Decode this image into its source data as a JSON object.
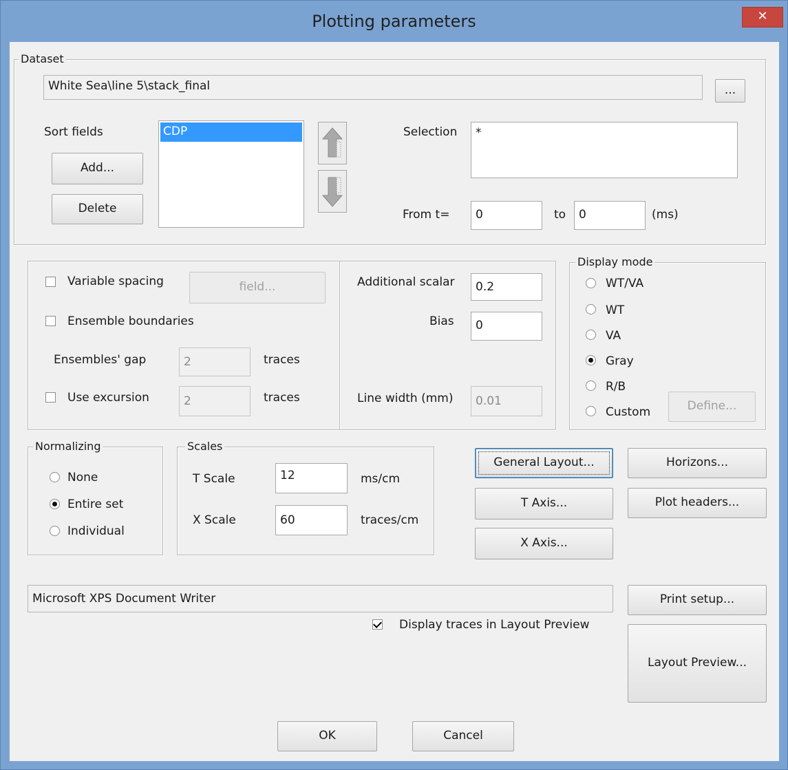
{
  "window": {
    "title": "Plotting parameters",
    "close_glyph": "✕"
  },
  "dataset": {
    "legend": "Dataset",
    "path": "White Sea\\line 5\\stack_final",
    "browse_label": "...",
    "sort_fields_label": "Sort fields",
    "add_label": "Add...",
    "delete_label": "Delete",
    "sort_list": [
      "CDP"
    ],
    "selection_label": "Selection",
    "selection_value": "*",
    "from_label": "From t=",
    "from_value": "0",
    "to_label": "to",
    "to_value": "0",
    "unit_label": "(ms)"
  },
  "options": {
    "variable_spacing_label": "Variable spacing",
    "variable_spacing_checked": false,
    "field_button_label": "field...",
    "ensemble_boundaries_label": "Ensemble boundaries",
    "ensemble_boundaries_checked": false,
    "ensembles_gap_label": "Ensembles' gap",
    "ensembles_gap_value": "2",
    "traces_label_1": "traces",
    "use_excursion_label": "Use excursion",
    "use_excursion_checked": false,
    "excursion_value": "2",
    "traces_label_2": "traces",
    "additional_scalar_label": "Additional scalar",
    "additional_scalar_value": "0.2",
    "bias_label": "Bias",
    "bias_value": "0",
    "line_width_label": "Line width (mm)",
    "line_width_value": "0.01"
  },
  "display_mode": {
    "legend": "Display mode",
    "options": [
      "WT/VA",
      "WT",
      "VA",
      "Gray",
      "R/B",
      "Custom"
    ],
    "selected": "Gray",
    "define_label": "Define..."
  },
  "normalizing": {
    "legend": "Normalizing",
    "options": [
      "None",
      "Entire set",
      "Individual"
    ],
    "selected": "Entire set"
  },
  "scales": {
    "legend": "Scales",
    "t_label": "T Scale",
    "t_value": "12",
    "t_unit": "ms/cm",
    "x_label": "X Scale",
    "x_value": "60",
    "x_unit": "traces/cm"
  },
  "buttons": {
    "general_layout": "General Layout...",
    "horizons": "Horizons...",
    "t_axis": "T Axis...",
    "plot_headers": "Plot headers...",
    "x_axis": "X Axis...",
    "print_setup": "Print setup...",
    "layout_preview": "Layout Preview...",
    "ok": "OK",
    "cancel": "Cancel"
  },
  "printer": {
    "name": "Microsoft XPS Document Writer"
  },
  "preview": {
    "display_traces_label": "Display traces in Layout Preview",
    "display_traces_checked": true
  }
}
